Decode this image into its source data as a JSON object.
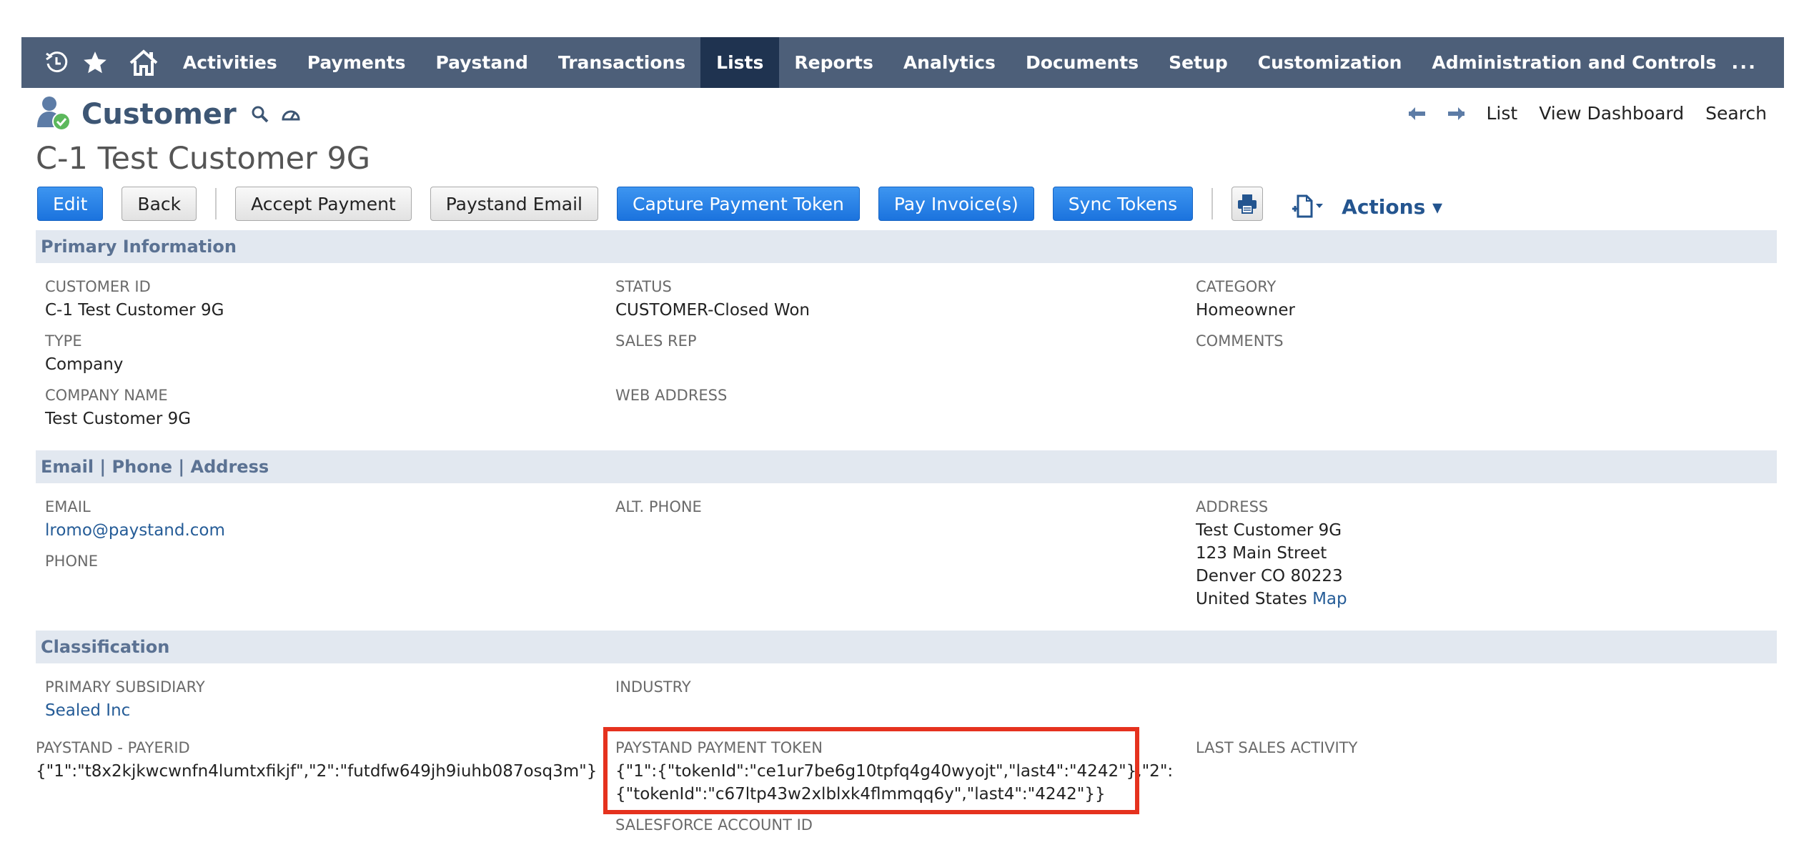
{
  "nav": {
    "items": [
      "Activities",
      "Payments",
      "Paystand",
      "Transactions",
      "Lists",
      "Reports",
      "Analytics",
      "Documents",
      "Setup",
      "Customization",
      "Administration and Controls"
    ],
    "active": "Lists",
    "more": "..."
  },
  "header": {
    "record_type": "Customer",
    "title": "C-1 Test Customer 9G",
    "right_links": {
      "list": "List",
      "view_dashboard": "View Dashboard",
      "search": "Search"
    }
  },
  "buttons": {
    "edit": "Edit",
    "back": "Back",
    "accept_payment": "Accept Payment",
    "paystand_email": "Paystand Email",
    "capture_payment_token": "Capture Payment Token",
    "pay_invoices": "Pay Invoice(s)",
    "sync_tokens": "Sync Tokens",
    "actions": "Actions ▾"
  },
  "sections": {
    "primary": {
      "title": "Primary Information",
      "customer_id_label": "CUSTOMER ID",
      "customer_id": "C-1 Test Customer 9G",
      "status_label": "STATUS",
      "status": "CUSTOMER-Closed Won",
      "category_label": "CATEGORY",
      "category": "Homeowner",
      "type_label": "TYPE",
      "type": "Company",
      "sales_rep_label": "SALES REP",
      "comments_label": "COMMENTS",
      "company_name_label": "COMPANY NAME",
      "company_name": "Test Customer 9G",
      "web_address_label": "WEB ADDRESS"
    },
    "contact": {
      "title": "Email | Phone | Address",
      "email_label": "EMAIL",
      "email": "lromo@paystand.com",
      "alt_phone_label": "ALT. PHONE",
      "phone_label": "PHONE",
      "address_label": "ADDRESS",
      "address_lines": [
        "Test Customer 9G",
        "123 Main Street",
        "Denver CO 80223",
        "United States"
      ],
      "map_link": "Map"
    },
    "classification": {
      "title": "Classification",
      "primary_subsidiary_label": "PRIMARY SUBSIDIARY",
      "primary_subsidiary": "Sealed Inc",
      "industry_label": "INDUSTRY",
      "payerid_label": "PAYSTAND - PAYERID",
      "payerid": "{\"1\":\"t8x2kjkwcwnfn4lumtxfikjf\",\"2\":\"futdfw649jh9iuhb087osq3m\"}",
      "payment_token_label": "PAYSTAND PAYMENT TOKEN",
      "payment_token_line1": "{\"1\":{\"tokenId\":\"ce1ur7be6g10tpfq4g40wyojt\",\"last4\":\"4242\"},\"2\":",
      "payment_token_line2": "{\"tokenId\":\"c67ltp43w2xlblxk4flmmqq6y\",\"last4\":\"4242\"}}",
      "last_sales_activity_label": "LAST SALES ACTIVITY",
      "salesforce_account_id_label": "SALESFORCE ACCOUNT ID"
    }
  },
  "colors": {
    "nav_bg": "#4d5f79",
    "nav_active": "#1f3350",
    "section_bg": "#e2e8f0",
    "highlight": "#e5321e",
    "primary_button": "#1b73de"
  }
}
